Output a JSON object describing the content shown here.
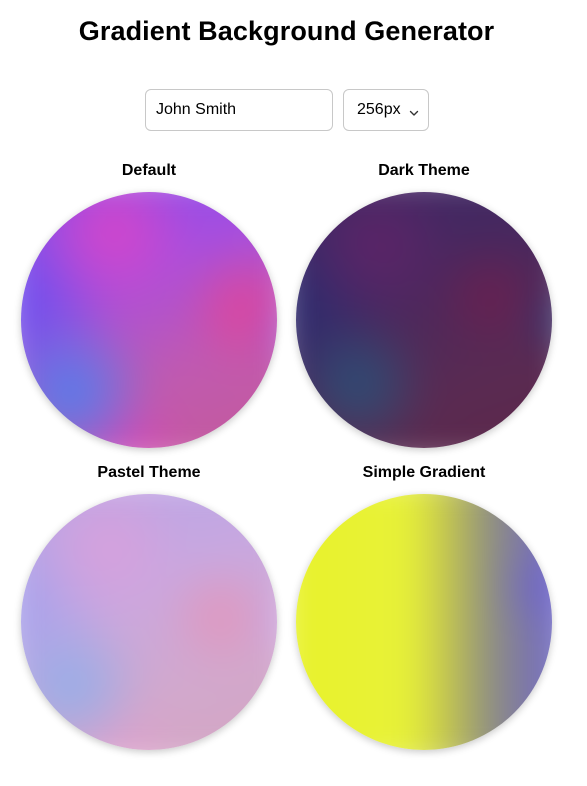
{
  "header": {
    "title": "Gradient Background Generator"
  },
  "controls": {
    "name_value": "John Smith",
    "name_placeholder": "",
    "size_value": "256px"
  },
  "avatars": [
    {
      "label": "Default",
      "palette": [
        "#7a4cf0",
        "#d845c8",
        "#e0449a",
        "#4d7ff0",
        "#c45a96"
      ]
    },
    {
      "label": "Dark Theme",
      "palette": [
        "#3a2868",
        "#5e2468",
        "#6a2050",
        "#2a5078",
        "#5c2848"
      ]
    },
    {
      "label": "Pastel Theme",
      "palette": [
        "#b4a4e8",
        "#d8a0dc",
        "#e296bc",
        "#92aeea",
        "#d4a6c0"
      ]
    },
    {
      "label": "Simple Gradient",
      "palette": [
        "#e8f22a",
        "#8a8a86",
        "#6d6ad4"
      ]
    }
  ],
  "icons": {
    "select_chevron": "chevron-down-icon"
  }
}
